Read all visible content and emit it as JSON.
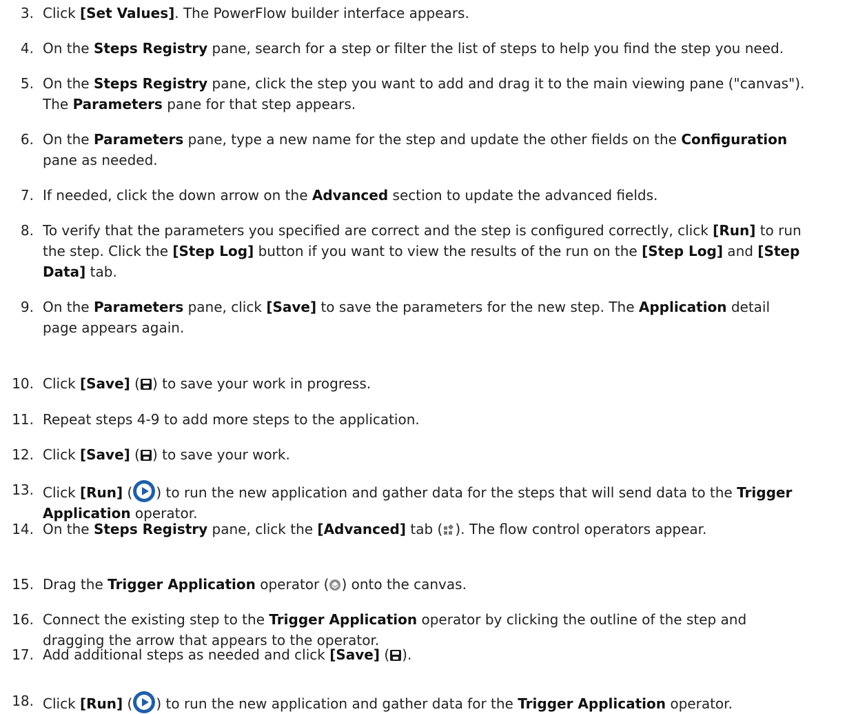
{
  "steps": [
    {
      "number": "3.",
      "parts": [
        {
          "t": "Click "
        },
        {
          "t": "[Set Values]",
          "b": true
        },
        {
          "t": ". The PowerFlow builder interface appears."
        }
      ]
    },
    {
      "number": "4.",
      "parts": [
        {
          "t": "On the "
        },
        {
          "t": "Steps Registry",
          "b": true
        },
        {
          "t": " pane, search for a step or filter the list of steps to help you find the step you need."
        }
      ]
    },
    {
      "number": "5.",
      "parts": [
        {
          "t": "On the "
        },
        {
          "t": "Steps Registry",
          "b": true
        },
        {
          "t": " pane, click the step you want to add and drag it to the main viewing pane (\"canvas\")."
        },
        {
          "br": true
        },
        {
          "t": "The "
        },
        {
          "t": "Parameters",
          "b": true
        },
        {
          "t": " pane for that step appears."
        }
      ]
    },
    {
      "number": "6.",
      "parts": [
        {
          "t": "On the "
        },
        {
          "t": "Parameters",
          "b": true
        },
        {
          "t": " pane, type a new name for the step and update the other fields on the "
        },
        {
          "t": "Configuration",
          "b": true
        },
        {
          "br": true
        },
        {
          "t": "pane as needed."
        }
      ]
    },
    {
      "number": "7.",
      "parts": [
        {
          "t": "If needed, click the down arrow on the "
        },
        {
          "t": "Advanced",
          "b": true
        },
        {
          "t": " section to update the advanced fields."
        }
      ]
    },
    {
      "number": "8.",
      "parts": [
        {
          "t": "To verify that the parameters you specified are correct and the step is configured correctly, click "
        },
        {
          "t": "[Run]",
          "b": true
        },
        {
          "t": " to run"
        },
        {
          "br": true
        },
        {
          "t": "the step. Click the "
        },
        {
          "t": "[Step Log]",
          "b": true
        },
        {
          "t": " button if you want to view the results of the run on the "
        },
        {
          "t": "[Step Log]",
          "b": true
        },
        {
          "t": " and "
        },
        {
          "t": "[Step",
          "b": true
        },
        {
          "br": true
        },
        {
          "t": "Data]",
          "b": true
        },
        {
          "t": " tab."
        }
      ]
    },
    {
      "number": "9.",
      "parts": [
        {
          "t": "On the "
        },
        {
          "t": "Parameters",
          "b": true
        },
        {
          "t": " pane, click "
        },
        {
          "t": "[Save]",
          "b": true
        },
        {
          "t": " to save the parameters for the new step. The "
        },
        {
          "t": "Application",
          "b": true
        },
        {
          "t": " detail"
        },
        {
          "br": true
        },
        {
          "t": "page appears again."
        }
      ]
    },
    {
      "number": "10.",
      "parts": [
        {
          "t": "Click "
        },
        {
          "t": "[Save]",
          "b": true
        },
        {
          "t": " ("
        },
        {
          "icon": "save-icon"
        },
        {
          "t": ") to save your work in progress."
        }
      ]
    },
    {
      "number": "11.",
      "parts": [
        {
          "t": "Repeat steps 4-9 to add more steps to the application."
        }
      ]
    },
    {
      "number": "12.",
      "parts": [
        {
          "t": "Click "
        },
        {
          "t": "[Save]",
          "b": true
        },
        {
          "t": " ("
        },
        {
          "icon": "save-icon"
        },
        {
          "t": ") to save your work."
        }
      ]
    },
    {
      "number": "13.",
      "parts": [
        {
          "t": "Click "
        },
        {
          "t": "[Run]",
          "b": true
        },
        {
          "t": " ("
        },
        {
          "icon": "play-icon"
        },
        {
          "t": ") to run the new application and gather data for the steps that will send data to the "
        },
        {
          "t": "Trigger",
          "b": true
        },
        {
          "br": true
        },
        {
          "t": "Application",
          "b": true
        },
        {
          "t": " operator."
        }
      ]
    },
    {
      "number": "14.",
      "parts": [
        {
          "t": "On the "
        },
        {
          "t": "Steps Registry",
          "b": true
        },
        {
          "t": " pane, click the "
        },
        {
          "t": "[Advanced]",
          "b": true
        },
        {
          "t": " tab ("
        },
        {
          "icon": "advanced-icon"
        },
        {
          "t": "). The flow control operators appear."
        }
      ]
    },
    {
      "number": "15.",
      "parts": [
        {
          "t": "Drag the "
        },
        {
          "t": "Trigger Application",
          "b": true
        },
        {
          "t": " operator ("
        },
        {
          "icon": "trigger-icon"
        },
        {
          "t": ") onto the canvas."
        }
      ]
    },
    {
      "number": "16.",
      "parts": [
        {
          "t": "Connect the existing step to the "
        },
        {
          "t": "Trigger Application",
          "b": true
        },
        {
          "t": " operator by clicking the outline of the step and"
        },
        {
          "br": true
        },
        {
          "t": "dragging the arrow that appears to the operator."
        }
      ]
    },
    {
      "number": "17.",
      "parts": [
        {
          "t": "Add additional steps as needed and click "
        },
        {
          "t": "[Save]",
          "b": true
        },
        {
          "t": " ("
        },
        {
          "icon": "save-icon"
        },
        {
          "t": ")."
        }
      ]
    },
    {
      "number": "18.",
      "parts": [
        {
          "t": "Click "
        },
        {
          "t": "[Run]",
          "b": true
        },
        {
          "t": " ("
        },
        {
          "icon": "play-icon"
        },
        {
          "t": ") to run the new application and gather data for the "
        },
        {
          "t": "Trigger Application",
          "b": true
        },
        {
          "t": " operator."
        }
      ]
    }
  ]
}
